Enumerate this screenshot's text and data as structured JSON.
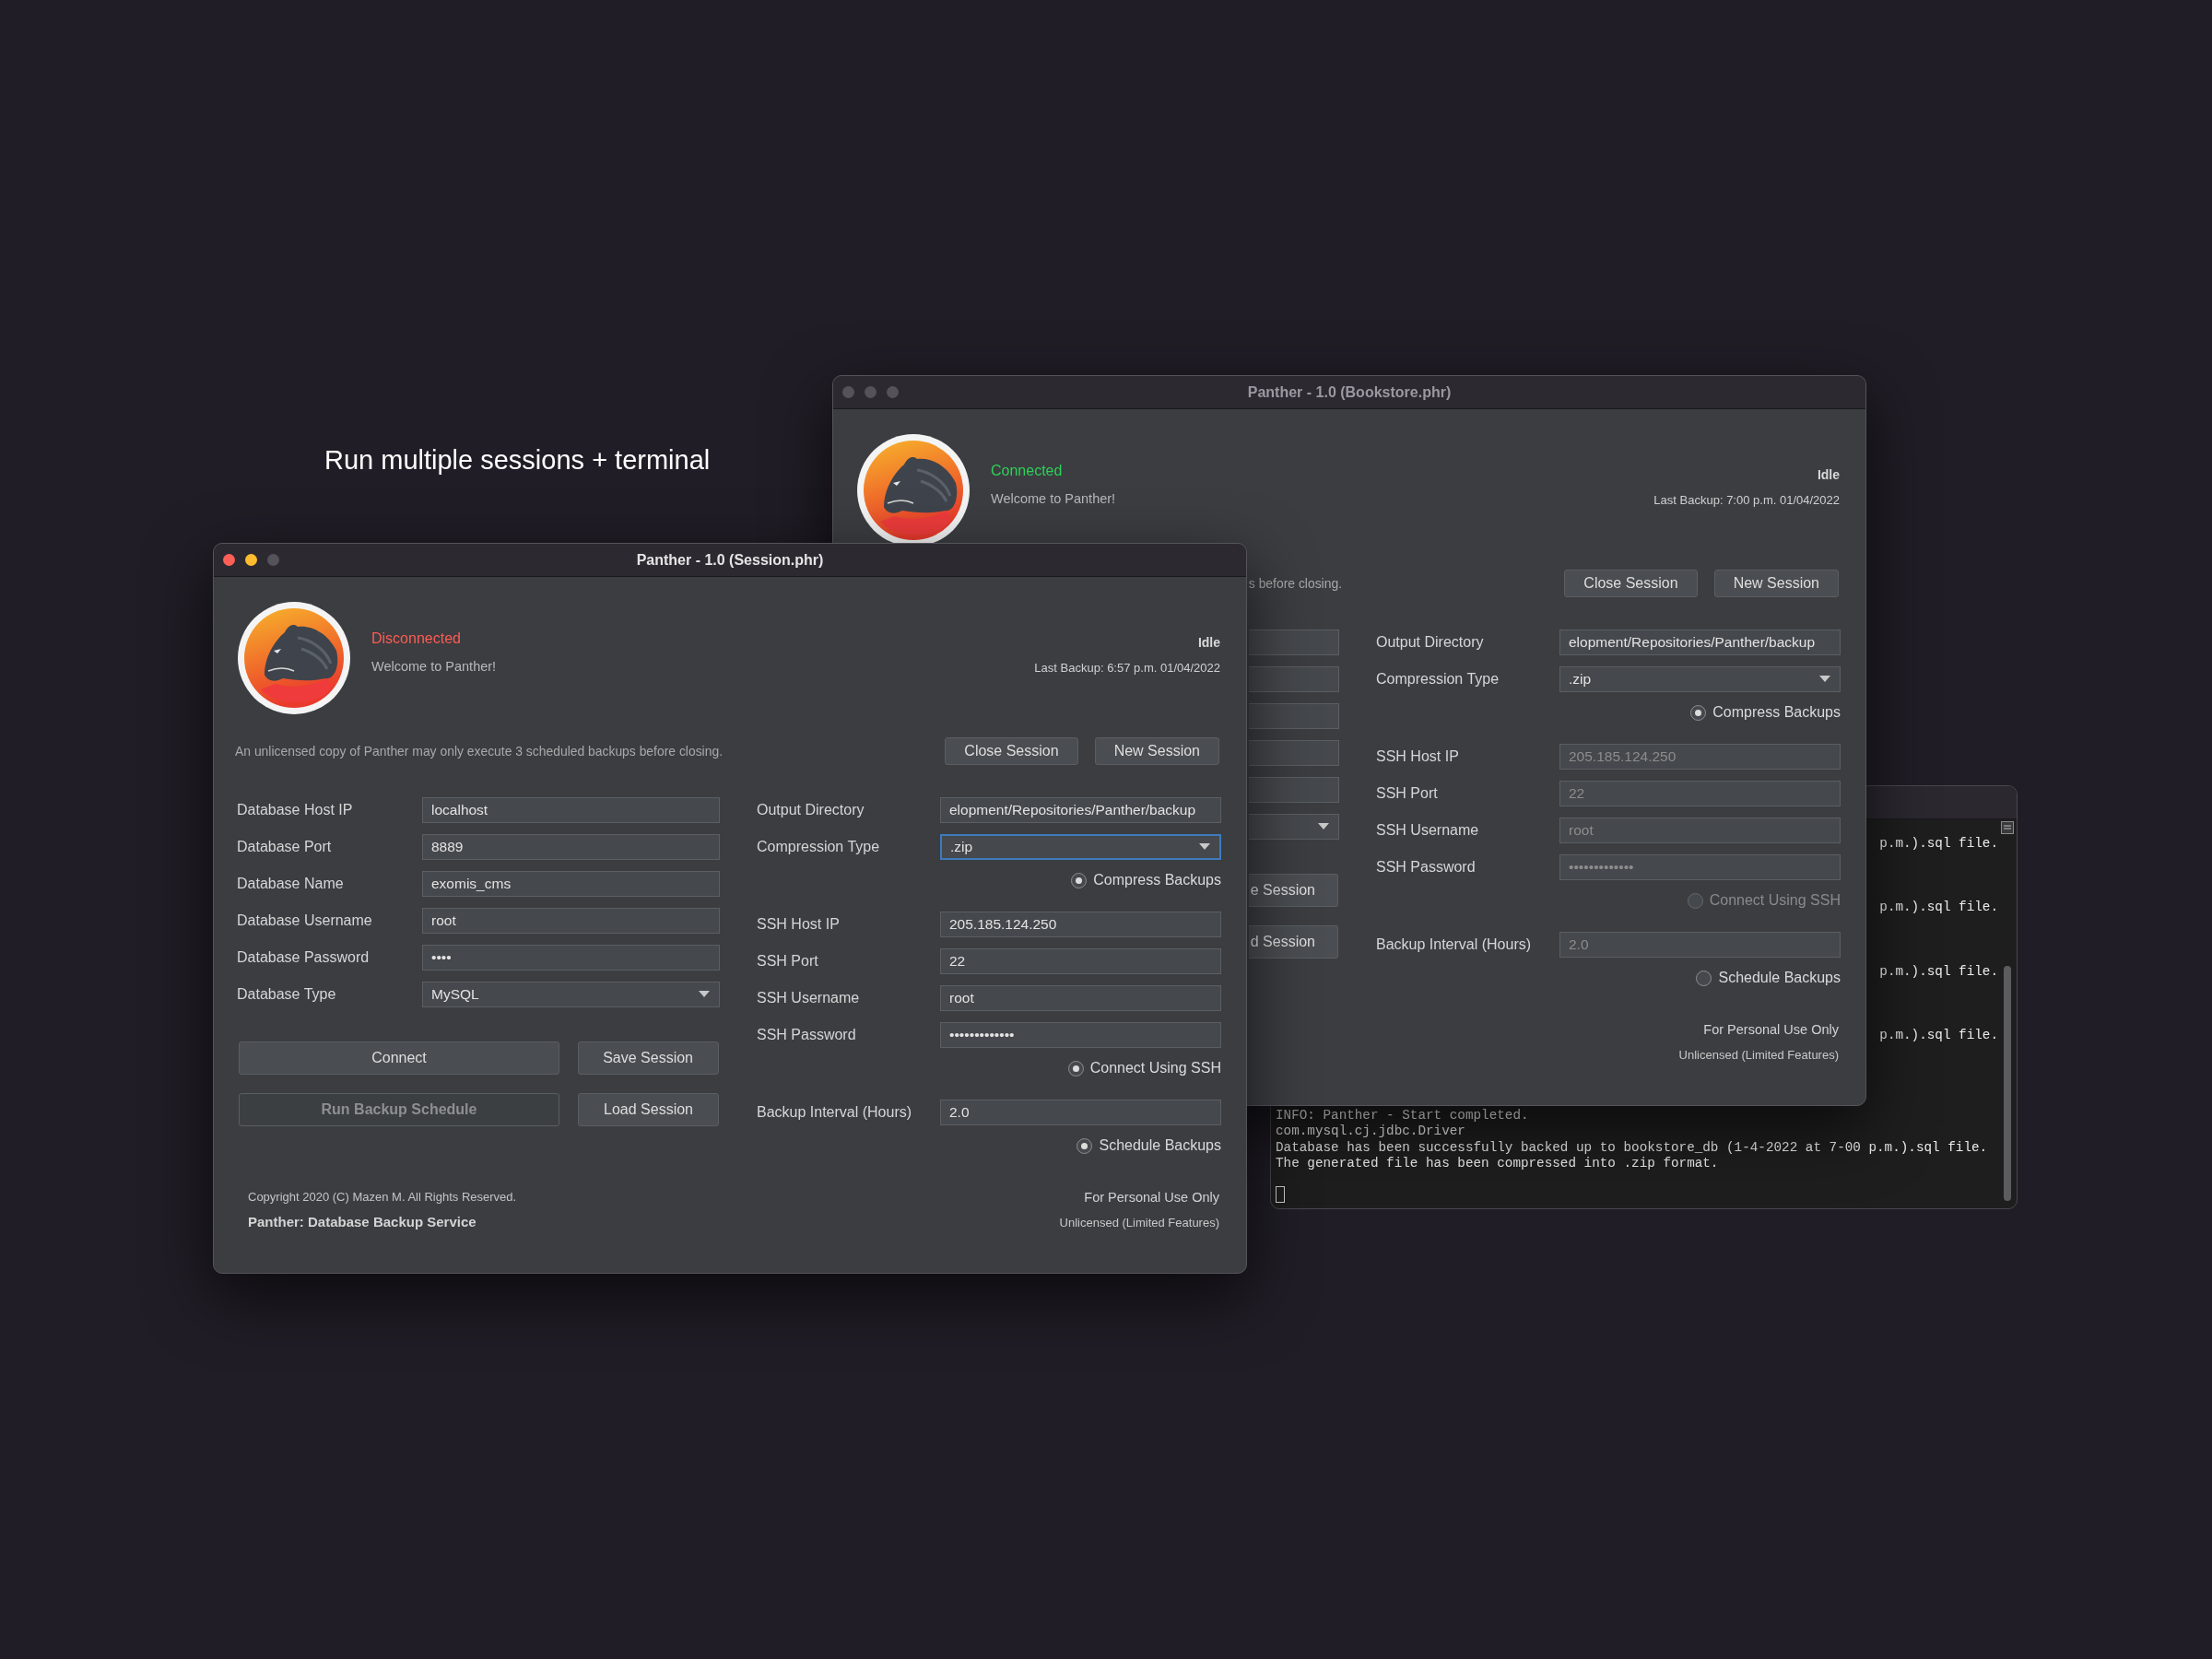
{
  "headline": "Run multiple sessions + terminal",
  "terminal": {
    "lines": [
      {
        "kind": "fragment",
        "text": "p.m.).sql file."
      },
      {
        "kind": "fragment",
        "text": "p.m.).sql file."
      },
      {
        "kind": "fragment",
        "text": "p.m.).sql file."
      },
      {
        "kind": "fragment",
        "text": "p.m.).sql file."
      },
      {
        "kind": "line",
        "text": "INFO: Panther - Start completed."
      },
      {
        "kind": "line",
        "text": "com.mysql.cj.jdbc.Driver"
      },
      {
        "kind": "line",
        "text": "Database has been successfully backed up to bookstore_db (1-4-2022 at 7-00 p.m.).sql file."
      },
      {
        "kind": "line",
        "text": "The generated file has been compressed into .zip format."
      }
    ]
  },
  "windows": [
    {
      "title": "Panther - 1.0 (Bookstore.phr)",
      "active": false,
      "status": {
        "kind": "connected",
        "text": "Connected"
      },
      "welcome": "Welcome to Panther!",
      "state": "Idle",
      "last_backup": "Last Backup: 7:00 p.m. 01/04/2022",
      "notice": "s before closing.",
      "session_buttons": [
        "Close Session",
        "New Session"
      ],
      "left_fields": [
        {
          "kind": "input_stub"
        },
        {
          "kind": "input_stub"
        },
        {
          "kind": "input_stub"
        },
        {
          "kind": "input_stub"
        },
        {
          "kind": "input_stub"
        },
        {
          "kind": "select_stub"
        }
      ],
      "left_buttons": [
        {
          "label": "e Session",
          "kind": "stub",
          "disabled": false
        },
        {
          "label": "d Session",
          "kind": "stub",
          "disabled": false
        }
      ],
      "right_fields": [
        {
          "kind": "input",
          "label": "Output Directory",
          "value": "elopment/Repositories/Panther/backup",
          "disabled": false,
          "focused": false
        },
        {
          "kind": "select",
          "label": "Compression Type",
          "value": ".zip",
          "disabled": false,
          "focused": false
        },
        {
          "kind": "radio",
          "label": "Compress Backups",
          "checked": true,
          "disabled": false
        },
        {
          "kind": "input",
          "label": "SSH Host IP",
          "value": "205.185.124.250",
          "disabled": true,
          "focused": false
        },
        {
          "kind": "input",
          "label": "SSH Port",
          "value": "22",
          "disabled": true,
          "focused": false
        },
        {
          "kind": "input",
          "label": "SSH Username",
          "value": "root",
          "disabled": true,
          "focused": false
        },
        {
          "kind": "input",
          "label": "SSH Password",
          "value": "•••••••••••••",
          "disabled": true,
          "focused": false
        },
        {
          "kind": "radio",
          "label": "Connect Using SSH",
          "checked": false,
          "disabled": true
        },
        {
          "kind": "input",
          "label": "Backup Interval (Hours)",
          "value": "2.0",
          "disabled": true,
          "focused": false
        },
        {
          "kind": "radio",
          "label": "Schedule Backups",
          "checked": false,
          "disabled": false
        }
      ],
      "footer_right": [
        "For Personal Use Only",
        "Unlicensed (Limited Features)"
      ]
    },
    {
      "title": "Panther - 1.0 (Session.phr)",
      "active": true,
      "status": {
        "kind": "disconnected",
        "text": "Disconnected"
      },
      "welcome": "Welcome to Panther!",
      "state": "Idle",
      "last_backup": "Last Backup: 6:57 p.m. 01/04/2022",
      "notice": "An unlicensed copy of Panther may only execute 3 scheduled backups before closing.",
      "session_buttons": [
        "Close Session",
        "New Session"
      ],
      "left_fields": [
        {
          "kind": "input",
          "label": "Database Host IP",
          "value": "localhost"
        },
        {
          "kind": "input",
          "label": "Database Port",
          "value": "8889"
        },
        {
          "kind": "input",
          "label": "Database Name",
          "value": "exomis_cms"
        },
        {
          "kind": "input",
          "label": "Database Username",
          "value": "root"
        },
        {
          "kind": "input",
          "label": "Database Password",
          "value": "••••"
        },
        {
          "kind": "select",
          "label": "Database Type",
          "value": "MySQL"
        }
      ],
      "left_buttons": [
        {
          "label": "Connect",
          "kind": "wide",
          "disabled": false
        },
        {
          "label": "Save Session",
          "kind": "narrow",
          "disabled": false
        },
        {
          "label": "Run Backup Schedule",
          "kind": "wide",
          "disabled": true
        },
        {
          "label": "Load Session",
          "kind": "narrow",
          "disabled": false
        }
      ],
      "right_fields": [
        {
          "kind": "input",
          "label": "Output Directory",
          "value": "elopment/Repositories/Panther/backup",
          "disabled": false,
          "focused": false
        },
        {
          "kind": "select",
          "label": "Compression Type",
          "value": ".zip",
          "disabled": false,
          "focused": true
        },
        {
          "kind": "radio",
          "label": "Compress Backups",
          "checked": true,
          "disabled": false
        },
        {
          "kind": "input",
          "label": "SSH Host IP",
          "value": "205.185.124.250",
          "disabled": false,
          "focused": false
        },
        {
          "kind": "input",
          "label": "SSH Port",
          "value": "22",
          "disabled": false,
          "focused": false
        },
        {
          "kind": "input",
          "label": "SSH Username",
          "value": "root",
          "disabled": false,
          "focused": false
        },
        {
          "kind": "input",
          "label": "SSH Password",
          "value": "•••••••••••••",
          "disabled": false,
          "focused": false
        },
        {
          "kind": "radio",
          "label": "Connect Using SSH",
          "checked": true,
          "disabled": false
        },
        {
          "kind": "input",
          "label": "Backup Interval (Hours)",
          "value": "2.0",
          "disabled": false,
          "focused": false
        },
        {
          "kind": "radio",
          "label": "Schedule Backups",
          "checked": true,
          "disabled": false
        }
      ],
      "footer_left": [
        {
          "kind": "copyright",
          "text": "Copyright 2020 (C) Mazen M. All Rights Reserved."
        },
        {
          "kind": "product",
          "text": "Panther: Database Backup Service"
        }
      ],
      "footer_right": [
        "For Personal Use Only",
        "Unlicensed (Limited Features)"
      ]
    }
  ]
}
